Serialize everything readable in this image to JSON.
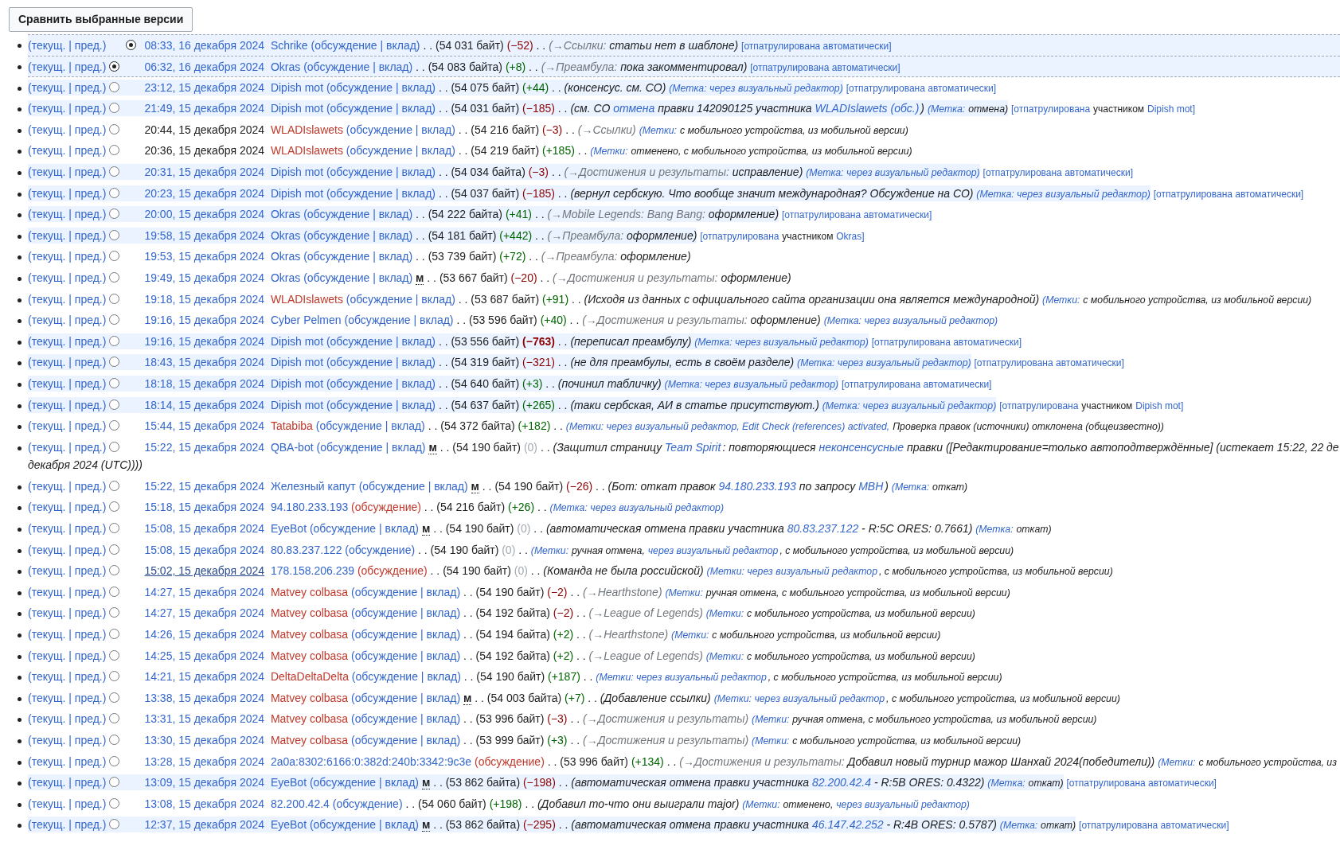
{
  "compare_button": "Сравнить выбранные версии",
  "rows": [
    {
      "cur": "(текущ.",
      "prev": "| пред.)",
      "second_radio": true,
      "selected": true,
      "highlighted": true,
      "time": {
        "text": "08:33, 16 декабря 2024",
        "color": "#3366cc",
        "visited": false
      },
      "user": "Schrike",
      "user_missing": false,
      "talk": "(обсуждение",
      "talk_missing": false,
      "contribs": "| вклад)",
      "size": ". . (54 031 байт)",
      "diff": {
        "text": "(−52)",
        "color": "#8b0000",
        "bold": false
      },
      "dots": ". .",
      "summary": [
        {
          "kind": "sec",
          "text": "(→Ссылки:"
        },
        {
          "kind": "txt",
          "text": "статьи нет в шаблоне)"
        },
        {
          "kind": "pat",
          "text": "[отпатрулирована автоматически]"
        }
      ]
    },
    {
      "cur": "(текущ.",
      "prev": "| пред.)",
      "second_radio": false,
      "selected": true,
      "highlighted": true,
      "time": {
        "text": "06:32, 16 декабря 2024",
        "color": "#3366cc",
        "visited": false
      },
      "user": "Okras",
      "user_missing": false,
      "talk": "(обсуждение",
      "talk_missing": false,
      "contribs": "| вклад)",
      "size": ". . (54 083 байта)",
      "diff": {
        "text": "(+8)",
        "color": "#006400",
        "bold": false
      },
      "dots": ". .",
      "summary": [
        {
          "kind": "sec",
          "text": "(→Преамбула:"
        },
        {
          "kind": "txt",
          "text": "пока закомментировал)"
        },
        {
          "kind": "pat",
          "text": "[отпатрулирована автоматически]"
        }
      ]
    },
    {
      "cur": "(текущ.",
      "prev": "| пред.)",
      "second_radio": false,
      "selected": false,
      "highlighted": true,
      "time": {
        "text": "23:12, 15 декабря 2024",
        "color": "#3366cc",
        "visited": false
      },
      "user": "Dipish mot",
      "user_missing": false,
      "talk": "(обсуждение",
      "talk_missing": false,
      "contribs": "| вклад)",
      "size": ". . (54 075 байт)",
      "diff": {
        "text": "(+44)",
        "color": "#006400",
        "bold": false
      },
      "dots": ". .",
      "summary": [
        {
          "kind": "txt",
          "text": "(консенсус. см. СО)"
        },
        {
          "kind": "tag",
          "text": "(Метка: через визуальный редактор)"
        },
        {
          "kind": "pat",
          "text": "[отпатрулирована автоматически]"
        }
      ]
    },
    {
      "cur": "(текущ.",
      "prev": "| пред.)",
      "second_radio": false,
      "selected": false,
      "highlighted": true,
      "time": {
        "text": "21:49, 15 декабря 2024",
        "color": "#3366cc",
        "visited": false
      },
      "user": "Dipish mot",
      "user_missing": false,
      "talk": "(обсуждение",
      "talk_missing": false,
      "contribs": "| вклад)",
      "size": ". . (54 031 байт)",
      "diff": {
        "text": "(−185)",
        "color": "#8b0000",
        "bold": false
      },
      "dots": ". .",
      "summary": [
        {
          "kind": "txt",
          "text": "(см. СО"
        },
        {
          "kind": "link",
          "text": "отмена"
        },
        {
          "kind": "txt",
          "text": "правки 142090125 участника"
        },
        {
          "kind": "link",
          "text": "WLADIslawets"
        },
        {
          "kind": "link",
          "text": "(обс.)"
        },
        {
          "kind": "txt",
          "text": ")",
          "nospace": true
        },
        {
          "kind": "tag",
          "text": "(Метка:"
        },
        {
          "kind": "ttx",
          "text": "отмена)"
        },
        {
          "kind": "pat",
          "text": "[отпатрулирована"
        },
        {
          "kind": "ptx",
          "text": "участником"
        },
        {
          "kind": "pat",
          "text": "Dipish mot]"
        }
      ]
    },
    {
      "cur": "(текущ.",
      "prev": "| пред.)",
      "second_radio": false,
      "selected": false,
      "highlighted": false,
      "time": {
        "text": "20:44, 15 декабря 2024",
        "color": "#202122",
        "visited": false
      },
      "user": "WLADIslawets",
      "user_missing": true,
      "talk": "(обсуждение",
      "talk_missing": false,
      "contribs": "| вклад)",
      "size": ". . (54 216 байт)",
      "diff": {
        "text": "(−3)",
        "color": "#8b0000",
        "bold": false
      },
      "dots": ". .",
      "summary": [
        {
          "kind": "sec",
          "text": "(→Ссылки)"
        },
        {
          "kind": "tag",
          "text": "(Метки:"
        },
        {
          "kind": "ttx",
          "text": "с мобильного устройства, из мобильной версии)"
        }
      ]
    },
    {
      "cur": "(текущ.",
      "prev": "| пред.)",
      "second_radio": false,
      "selected": false,
      "highlighted": false,
      "time": {
        "text": "20:36, 15 декабря 2024",
        "color": "#202122",
        "visited": false
      },
      "user": "WLADIslawets",
      "user_missing": true,
      "talk": "(обсуждение",
      "talk_missing": false,
      "contribs": "| вклад)",
      "size": ". . (54 219 байт)",
      "diff": {
        "text": "(+185)",
        "color": "#006400",
        "bold": false
      },
      "dots": ". .",
      "summary": [
        {
          "kind": "tag",
          "text": "(Метки:"
        },
        {
          "kind": "ttx",
          "text": "отменено, с мобильного устройства, из мобильной версии)"
        }
      ]
    },
    {
      "cur": "(текущ.",
      "prev": "| пред.)",
      "second_radio": false,
      "selected": false,
      "highlighted": true,
      "time": {
        "text": "20:31, 15 декабря 2024",
        "color": "#3366cc",
        "visited": false
      },
      "user": "Dipish mot",
      "user_missing": false,
      "talk": "(обсуждение",
      "talk_missing": false,
      "contribs": "| вклад)",
      "size": ". . (54 034 байта)",
      "diff": {
        "text": "(−3)",
        "color": "#8b0000",
        "bold": false
      },
      "dots": ". .",
      "summary": [
        {
          "kind": "sec",
          "text": "(→Достижения и результаты:"
        },
        {
          "kind": "txt",
          "text": "исправление)"
        },
        {
          "kind": "tag",
          "text": "(Метка: через визуальный редактор)"
        },
        {
          "kind": "pat",
          "text": "[отпатрулирована автоматически]"
        }
      ]
    },
    {
      "cur": "(текущ.",
      "prev": "| пред.)",
      "second_radio": false,
      "selected": false,
      "highlighted": true,
      "time": {
        "text": "20:23, 15 декабря 2024",
        "color": "#3366cc",
        "visited": false
      },
      "user": "Dipish mot",
      "user_missing": false,
      "talk": "(обсуждение",
      "talk_missing": false,
      "contribs": "| вклад)",
      "size": ". . (54 037 байт)",
      "diff": {
        "text": "(−185)",
        "color": "#8b0000",
        "bold": false
      },
      "dots": ". .",
      "summary": [
        {
          "kind": "txt",
          "text": "(вернул сербскую. Что вообще значит международная? Обсуждение на СО)"
        },
        {
          "kind": "tag",
          "text": "(Метка: через визуальный редактор)"
        },
        {
          "kind": "pat",
          "text": "[отпатрулирована автоматически]"
        }
      ]
    },
    {
      "cur": "(текущ.",
      "prev": "| пред.)",
      "second_radio": false,
      "selected": false,
      "highlighted": true,
      "time": {
        "text": "20:00, 15 декабря 2024",
        "color": "#3366cc",
        "visited": false
      },
      "user": "Okras",
      "user_missing": false,
      "talk": "(обсуждение",
      "talk_missing": false,
      "contribs": "| вклад)",
      "size": ". . (54 222 байта)",
      "diff": {
        "text": "(+41)",
        "color": "#006400",
        "bold": false
      },
      "dots": ". .",
      "summary": [
        {
          "kind": "sec",
          "text": "(→Mobile Legends: Bang Bang:"
        },
        {
          "kind": "txt",
          "text": "оформление)"
        },
        {
          "kind": "pat",
          "text": "[отпатрулирована автоматически]"
        }
      ]
    },
    {
      "cur": "(текущ.",
      "prev": "| пред.)",
      "second_radio": false,
      "selected": false,
      "highlighted": true,
      "time": {
        "text": "19:58, 15 декабря 2024",
        "color": "#3366cc",
        "visited": false
      },
      "user": "Okras",
      "user_missing": false,
      "talk": "(обсуждение",
      "talk_missing": false,
      "contribs": "| вклад)",
      "size": ". . (54 181 байт)",
      "diff": {
        "text": "(+442)",
        "color": "#006400",
        "bold": false
      },
      "dots": ". .",
      "summary": [
        {
          "kind": "sec",
          "text": "(→Преамбула:"
        },
        {
          "kind": "txt",
          "text": "оформление)"
        },
        {
          "kind": "pat",
          "text": "[отпатрулирована"
        },
        {
          "kind": "ptx",
          "text": "участником"
        },
        {
          "kind": "pat",
          "text": "Okras]"
        }
      ]
    },
    {
      "cur": "(текущ.",
      "prev": "| пред.)",
      "second_radio": false,
      "selected": false,
      "highlighted": false,
      "time": {
        "text": "19:53, 15 декабря 2024",
        "color": "#3366cc",
        "visited": false
      },
      "user": "Okras",
      "user_missing": false,
      "talk": "(обсуждение",
      "talk_missing": false,
      "contribs": "| вклад)",
      "size": ". . (53 739 байт)",
      "diff": {
        "text": "(+72)",
        "color": "#006400",
        "bold": false
      },
      "dots": ". .",
      "summary": [
        {
          "kind": "sec",
          "text": "(→Преамбула:"
        },
        {
          "kind": "txt",
          "text": "оформление)"
        }
      ]
    },
    {
      "cur": "(текущ.",
      "prev": "| пред.)",
      "second_radio": false,
      "selected": false,
      "highlighted": false,
      "time": {
        "text": "19:49, 15 декабря 2024",
        "color": "#3366cc",
        "visited": false
      },
      "user": "Okras",
      "user_missing": false,
      "talk": "(обсуждение",
      "talk_missing": false,
      "contribs": "| вклад)",
      "minor": "м",
      "size": ". . (53 667 байт)",
      "diff": {
        "text": "(−20)",
        "color": "#8b0000",
        "bold": false
      },
      "dots": ". .",
      "summary": [
        {
          "kind": "sec",
          "text": "(→Достижения и результаты:"
        },
        {
          "kind": "txt",
          "text": "оформление)"
        }
      ]
    },
    {
      "cur": "(текущ.",
      "prev": "| пред.)",
      "second_radio": false,
      "selected": false,
      "highlighted": false,
      "time": {
        "text": "19:18, 15 декабря 2024",
        "color": "#3366cc",
        "visited": false
      },
      "user": "WLADIslawets",
      "user_missing": true,
      "talk": "(обсуждение",
      "talk_missing": false,
      "contribs": "| вклад)",
      "size": ". . (53 687 байт)",
      "diff": {
        "text": "(+91)",
        "color": "#006400",
        "bold": false
      },
      "dots": ". .",
      "summary": [
        {
          "kind": "txt",
          "text": "(Исходя из данных с официального сайта организации она является международной)"
        },
        {
          "kind": "tag",
          "text": "(Метки:"
        },
        {
          "kind": "ttx",
          "text": "с мобильного устройства, из мобильной версии)"
        }
      ]
    },
    {
      "cur": "(текущ.",
      "prev": "| пред.)",
      "second_radio": false,
      "selected": false,
      "highlighted": false,
      "time": {
        "text": "19:16, 15 декабря 2024",
        "color": "#3366cc",
        "visited": false
      },
      "user": "Cyber Pelmen",
      "user_missing": false,
      "talk": "(обсуждение",
      "talk_missing": false,
      "contribs": "| вклад)",
      "size": ". . (53 596 байт)",
      "diff": {
        "text": "(+40)",
        "color": "#006400",
        "bold": false
      },
      "dots": ". .",
      "summary": [
        {
          "kind": "sec",
          "text": "(→Достижения и результаты:"
        },
        {
          "kind": "txt",
          "text": "оформление)"
        },
        {
          "kind": "tag",
          "text": "(Метка: через визуальный редактор)"
        }
      ]
    },
    {
      "cur": "(текущ.",
      "prev": "| пред.)",
      "second_radio": false,
      "selected": false,
      "highlighted": true,
      "time": {
        "text": "19:16, 15 декабря 2024",
        "color": "#3366cc",
        "visited": false
      },
      "user": "Dipish mot",
      "user_missing": false,
      "talk": "(обсуждение",
      "talk_missing": false,
      "contribs": "| вклад)",
      "size": ". . (53 556 байт)",
      "diff": {
        "text": "(−763)",
        "color": "#8b0000",
        "bold": true
      },
      "dots": ". .",
      "summary": [
        {
          "kind": "txt",
          "text": "(переписал преамбулу)"
        },
        {
          "kind": "tag",
          "text": "(Метка: через визуальный редактор)"
        },
        {
          "kind": "pat",
          "text": "[отпатрулирована автоматически]"
        }
      ]
    },
    {
      "cur": "(текущ.",
      "prev": "| пред.)",
      "second_radio": false,
      "selected": false,
      "highlighted": true,
      "time": {
        "text": "18:43, 15 декабря 2024",
        "color": "#3366cc",
        "visited": false
      },
      "user": "Dipish mot",
      "user_missing": false,
      "talk": "(обсуждение",
      "talk_missing": false,
      "contribs": "| вклад)",
      "size": ". . (54 319 байт)",
      "diff": {
        "text": "(−321)",
        "color": "#8b0000",
        "bold": false
      },
      "dots": ". .",
      "summary": [
        {
          "kind": "txt",
          "text": "(не для преамбулы, есть в своём разделе)"
        },
        {
          "kind": "tag",
          "text": "(Метка: через визуальный редактор)"
        },
        {
          "kind": "pat",
          "text": "[отпатрулирована автоматически]"
        }
      ]
    },
    {
      "cur": "(текущ.",
      "prev": "| пред.)",
      "second_radio": false,
      "selected": false,
      "highlighted": true,
      "time": {
        "text": "18:18, 15 декабря 2024",
        "color": "#3366cc",
        "visited": false
      },
      "user": "Dipish mot",
      "user_missing": false,
      "talk": "(обсуждение",
      "talk_missing": false,
      "contribs": "| вклад)",
      "size": ". . (54 640 байт)",
      "diff": {
        "text": "(+3)",
        "color": "#006400",
        "bold": false
      },
      "dots": ". .",
      "summary": [
        {
          "kind": "txt",
          "text": "(починил табличку)"
        },
        {
          "kind": "tag",
          "text": "(Метка: через визуальный редактор)"
        },
        {
          "kind": "pat",
          "text": "[отпатрулирована автоматически]"
        }
      ]
    },
    {
      "cur": "(текущ.",
      "prev": "| пред.)",
      "second_radio": false,
      "selected": false,
      "highlighted": true,
      "time": {
        "text": "18:14, 15 декабря 2024",
        "color": "#3366cc",
        "visited": false
      },
      "user": "Dipish mot",
      "user_missing": false,
      "talk": "(обсуждение",
      "talk_missing": false,
      "contribs": "| вклад)",
      "size": ". . (54 637 байт)",
      "diff": {
        "text": "(+265)",
        "color": "#006400",
        "bold": false
      },
      "dots": ". .",
      "summary": [
        {
          "kind": "txt",
          "text": "(таки сербская, АИ в статье присутствуют.)"
        },
        {
          "kind": "tag",
          "text": "(Метка: через визуальный редактор)"
        },
        {
          "kind": "pat",
          "text": "[отпатрулирована"
        },
        {
          "kind": "ptx",
          "text": "участником"
        },
        {
          "kind": "pat",
          "text": "Dipish mot]"
        }
      ]
    },
    {
      "cur": "(текущ.",
      "prev": "| пред.)",
      "second_radio": false,
      "selected": false,
      "highlighted": false,
      "time": {
        "text": "15:44, 15 декабря 2024",
        "color": "#3366cc",
        "visited": false
      },
      "user": "Tatabiba",
      "user_missing": true,
      "talk": "(обсуждение",
      "talk_missing": false,
      "contribs": "| вклад)",
      "size": ". . (54 372 байта)",
      "diff": {
        "text": "(+182)",
        "color": "#006400",
        "bold": false
      },
      "dots": ". .",
      "summary": [
        {
          "kind": "tag",
          "text": "(Метки: через визуальный редактор, Edit Check (references) activated,"
        },
        {
          "kind": "ttx",
          "text": "Проверка правок (источники) отклонена (общеизвестно))"
        }
      ]
    },
    {
      "cur": "(текущ.",
      "prev": "| пред.)",
      "second_radio": false,
      "selected": false,
      "highlighted": false,
      "time": {
        "text": "15:22, 15 декабря 2024",
        "color": "#3366cc",
        "visited": false
      },
      "user": "QBA-bot",
      "user_missing": false,
      "talk": "(обсуждение",
      "talk_missing": false,
      "contribs": "| вклад)",
      "minor": "м",
      "size": ". . (54 190 байт)",
      "diff": {
        "text": "(0)",
        "color": "#a2a9b1",
        "bold": false
      },
      "dots": ". .",
      "summary": [
        {
          "kind": "txt",
          "text": "(Защитил страницу"
        },
        {
          "kind": "link",
          "text": "Team Spirit"
        },
        {
          "kind": "txt",
          "text": ": повторяющиеся",
          "nospace": true
        },
        {
          "kind": "link",
          "text": "неконсенсусные"
        },
        {
          "kind": "txt",
          "text": "правки ([Редактирование=только автоподтверждённые] (истекает 15:22, 22 де"
        },
        {
          "kind": "txt",
          "text": "декабря 2024 (UTC))))",
          "newline": true
        }
      ]
    },
    {
      "cur": "(текущ.",
      "prev": "| пред.)",
      "second_radio": false,
      "selected": false,
      "highlighted": false,
      "time": {
        "text": "15:22, 15 декабря 2024",
        "color": "#3366cc",
        "visited": false
      },
      "user": "Железный капут",
      "user_missing": false,
      "talk": "(обсуждение",
      "talk_missing": false,
      "contribs": "| вклад)",
      "minor": "м",
      "size": ". . (54 190 байт)",
      "diff": {
        "text": "(−26)",
        "color": "#8b0000",
        "bold": false
      },
      "dots": ". .",
      "summary": [
        {
          "kind": "txt",
          "text": "(Бот: откат правок"
        },
        {
          "kind": "link",
          "text": "94.180.233.193"
        },
        {
          "kind": "txt",
          "text": "по запросу"
        },
        {
          "kind": "link",
          "text": "MBH"
        },
        {
          "kind": "txt",
          "text": ")",
          "nospace": true
        },
        {
          "kind": "tag",
          "text": "(Метка:"
        },
        {
          "kind": "ttx",
          "text": "откат)"
        }
      ]
    },
    {
      "cur": "(текущ.",
      "prev": "| пред.)",
      "second_radio": false,
      "selected": false,
      "highlighted": false,
      "time": {
        "text": "15:18, 15 декабря 2024",
        "color": "#3366cc",
        "visited": false
      },
      "user": "94.180.233.193",
      "user_missing": false,
      "talk": "(обсуждение)",
      "talk_missing": true,
      "size": ". . (54 216 байт)",
      "diff": {
        "text": "(+26)",
        "color": "#006400",
        "bold": false
      },
      "dots": ". .",
      "summary": [
        {
          "kind": "tag",
          "text": "(Метка: через визуальный редактор)"
        }
      ]
    },
    {
      "cur": "(текущ.",
      "prev": "| пред.)",
      "second_radio": false,
      "selected": false,
      "highlighted": false,
      "time": {
        "text": "15:08, 15 декабря 2024",
        "color": "#3366cc",
        "visited": false
      },
      "user": "EyeBot",
      "user_missing": false,
      "talk": "(обсуждение",
      "talk_missing": false,
      "contribs": "| вклад)",
      "minor": "м",
      "size": ". . (54 190 байт)",
      "diff": {
        "text": "(0)",
        "color": "#a2a9b1",
        "bold": false
      },
      "dots": ". .",
      "summary": [
        {
          "kind": "txt",
          "text": "(автоматическая отмена правки участника"
        },
        {
          "kind": "link",
          "text": "80.83.237.122"
        },
        {
          "kind": "txt",
          "text": "- R:5C ORES: 0.7661)"
        },
        {
          "kind": "tag",
          "text": "(Метка:"
        },
        {
          "kind": "ttx",
          "text": "откат)"
        }
      ]
    },
    {
      "cur": "(текущ.",
      "prev": "| пред.)",
      "second_radio": false,
      "selected": false,
      "highlighted": false,
      "time": {
        "text": "15:08, 15 декабря 2024",
        "color": "#3366cc",
        "visited": false
      },
      "user": "80.83.237.122",
      "user_missing": false,
      "talk": "(обсуждение)",
      "talk_missing": false,
      "size": ". . (54 190 байт)",
      "diff": {
        "text": "(0)",
        "color": "#a2a9b1",
        "bold": false
      },
      "dots": ". .",
      "summary": [
        {
          "kind": "tag",
          "text": "(Метки:"
        },
        {
          "kind": "ttx",
          "text": "ручная отмена,"
        },
        {
          "kind": "tag",
          "text": "через визуальный редактор"
        },
        {
          "kind": "ttx",
          "text": ", с мобильного устройства, из мобильной версии)",
          "nospace": true
        }
      ]
    },
    {
      "cur": "(текущ.",
      "prev": "| пред.)",
      "second_radio": false,
      "selected": false,
      "highlighted": false,
      "time": {
        "text": "15:02, 15 декабря 2024",
        "color": "#2a4b8d",
        "visited": true
      },
      "user": "178.158.206.239",
      "user_missing": false,
      "talk": "(обсуждение)",
      "talk_missing": true,
      "size": ". . (54 190 байт)",
      "diff": {
        "text": "(0)",
        "color": "#a2a9b1",
        "bold": false
      },
      "dots": ". .",
      "summary": [
        {
          "kind": "txt",
          "text": "(Команда не была российской)"
        },
        {
          "kind": "tag",
          "text": "(Метки: через визуальный редактор"
        },
        {
          "kind": "ttx",
          "text": ", с мобильного устройства, из мобильной версии)",
          "nospace": true
        }
      ]
    },
    {
      "cur": "(текущ.",
      "prev": "| пред.)",
      "second_radio": false,
      "selected": false,
      "highlighted": false,
      "time": {
        "text": "14:27, 15 декабря 2024",
        "color": "#3366cc",
        "visited": false
      },
      "user": "Matvey colbasa",
      "user_missing": true,
      "talk": "(обсуждение",
      "talk_missing": false,
      "contribs": "| вклад)",
      "size": ". . (54 190 байт)",
      "diff": {
        "text": "(−2)",
        "color": "#8b0000",
        "bold": false
      },
      "dots": ". .",
      "summary": [
        {
          "kind": "sec",
          "text": "(→Hearthstone)"
        },
        {
          "kind": "tag",
          "text": "(Метки:"
        },
        {
          "kind": "ttx",
          "text": "ручная отмена, с мобильного устройства, из мобильной версии)"
        }
      ]
    },
    {
      "cur": "(текущ.",
      "prev": "| пред.)",
      "second_radio": false,
      "selected": false,
      "highlighted": false,
      "time": {
        "text": "14:27, 15 декабря 2024",
        "color": "#3366cc",
        "visited": false
      },
      "user": "Matvey colbasa",
      "user_missing": true,
      "talk": "(обсуждение",
      "talk_missing": false,
      "contribs": "| вклад)",
      "size": ". . (54 192 байта)",
      "diff": {
        "text": "(−2)",
        "color": "#8b0000",
        "bold": false
      },
      "dots": ". .",
      "summary": [
        {
          "kind": "sec",
          "text": "(→League of Legends)"
        },
        {
          "kind": "tag",
          "text": "(Метки:"
        },
        {
          "kind": "ttx",
          "text": "с мобильного устройства, из мобильной версии)"
        }
      ]
    },
    {
      "cur": "(текущ.",
      "prev": "| пред.)",
      "second_radio": false,
      "selected": false,
      "highlighted": false,
      "time": {
        "text": "14:26, 15 декабря 2024",
        "color": "#3366cc",
        "visited": false
      },
      "user": "Matvey colbasa",
      "user_missing": true,
      "talk": "(обсуждение",
      "talk_missing": false,
      "contribs": "| вклад)",
      "size": ". . (54 194 байта)",
      "diff": {
        "text": "(+2)",
        "color": "#006400",
        "bold": false
      },
      "dots": ". .",
      "summary": [
        {
          "kind": "sec",
          "text": "(→Hearthstone)"
        },
        {
          "kind": "tag",
          "text": "(Метки:"
        },
        {
          "kind": "ttx",
          "text": "с мобильного устройства, из мобильной версии)"
        }
      ]
    },
    {
      "cur": "(текущ.",
      "prev": "| пред.)",
      "second_radio": false,
      "selected": false,
      "highlighted": false,
      "time": {
        "text": "14:25, 15 декабря 2024",
        "color": "#3366cc",
        "visited": false
      },
      "user": "Matvey colbasa",
      "user_missing": true,
      "talk": "(обсуждение",
      "talk_missing": false,
      "contribs": "| вклад)",
      "size": ". . (54 192 байта)",
      "diff": {
        "text": "(+2)",
        "color": "#006400",
        "bold": false
      },
      "dots": ". .",
      "summary": [
        {
          "kind": "sec",
          "text": "(→League of Legends)"
        },
        {
          "kind": "tag",
          "text": "(Метки:"
        },
        {
          "kind": "ttx",
          "text": "с мобильного устройства, из мобильной версии)"
        }
      ]
    },
    {
      "cur": "(текущ.",
      "prev": "| пред.)",
      "second_radio": false,
      "selected": false,
      "highlighted": false,
      "time": {
        "text": "14:21, 15 декабря 2024",
        "color": "#3366cc",
        "visited": false
      },
      "user": "DeltaDeltaDelta",
      "user_missing": true,
      "talk": "(обсуждение",
      "talk_missing": false,
      "contribs": "| вклад)",
      "size": ". . (54 190 байт)",
      "diff": {
        "text": "(+187)",
        "color": "#006400",
        "bold": false
      },
      "dots": ". .",
      "summary": [
        {
          "kind": "tag",
          "text": "(Метки: через визуальный редактор"
        },
        {
          "kind": "ttx",
          "text": ", с мобильного устройства, из мобильной версии)",
          "nospace": true
        }
      ]
    },
    {
      "cur": "(текущ.",
      "prev": "| пред.)",
      "second_radio": false,
      "selected": false,
      "highlighted": false,
      "time": {
        "text": "13:38, 15 декабря 2024",
        "color": "#3366cc",
        "visited": false
      },
      "user": "Matvey colbasa",
      "user_missing": true,
      "talk": "(обсуждение",
      "talk_missing": false,
      "contribs": "| вклад)",
      "minor": "м",
      "size": ". . (54 003 байта)",
      "diff": {
        "text": "(+7)",
        "color": "#006400",
        "bold": false
      },
      "dots": ". .",
      "summary": [
        {
          "kind": "txt",
          "text": "(Добавление ссылки)"
        },
        {
          "kind": "tag",
          "text": "(Метки: через визуальный редактор"
        },
        {
          "kind": "ttx",
          "text": ", с мобильного устройства, из мобильной версии)",
          "nospace": true
        }
      ]
    },
    {
      "cur": "(текущ.",
      "prev": "| пред.)",
      "second_radio": false,
      "selected": false,
      "highlighted": false,
      "time": {
        "text": "13:31, 15 декабря 2024",
        "color": "#3366cc",
        "visited": false
      },
      "user": "Matvey colbasa",
      "user_missing": true,
      "talk": "(обсуждение",
      "talk_missing": false,
      "contribs": "| вклад)",
      "size": ". . (53 996 байт)",
      "diff": {
        "text": "(−3)",
        "color": "#8b0000",
        "bold": false
      },
      "dots": ". .",
      "summary": [
        {
          "kind": "sec",
          "text": "(→Достижения и результаты)"
        },
        {
          "kind": "tag",
          "text": "(Метки:"
        },
        {
          "kind": "ttx",
          "text": "ручная отмена, с мобильного устройства, из мобильной версии)"
        }
      ]
    },
    {
      "cur": "(текущ.",
      "prev": "| пред.)",
      "second_radio": false,
      "selected": false,
      "highlighted": false,
      "time": {
        "text": "13:30, 15 декабря 2024",
        "color": "#3366cc",
        "visited": false
      },
      "user": "Matvey colbasa",
      "user_missing": true,
      "talk": "(обсуждение",
      "talk_missing": false,
      "contribs": "| вклад)",
      "size": ". . (53 999 байт)",
      "diff": {
        "text": "(+3)",
        "color": "#006400",
        "bold": false
      },
      "dots": ". .",
      "summary": [
        {
          "kind": "sec",
          "text": "(→Достижения и результаты)"
        },
        {
          "kind": "tag",
          "text": "(Метки:"
        },
        {
          "kind": "ttx",
          "text": "с мобильного устройства, из мобильной версии)"
        }
      ]
    },
    {
      "cur": "(текущ.",
      "prev": "| пред.)",
      "second_radio": false,
      "selected": false,
      "highlighted": false,
      "time": {
        "text": "13:28, 15 декабря 2024",
        "color": "#3366cc",
        "visited": false
      },
      "user": "2a0a:8302:6166:0:382d:240b:3342:9c3e",
      "user_missing": false,
      "talk": "(обсуждение)",
      "talk_missing": true,
      "size": ". . (53 996 байт)",
      "diff": {
        "text": "(+134)",
        "color": "#006400",
        "bold": false
      },
      "dots": ". .",
      "summary": [
        {
          "kind": "sec",
          "text": "(→Достижения и результаты:"
        },
        {
          "kind": "txt",
          "text": "Добавил новый турнир мажор Шанхай 2024(победители))"
        },
        {
          "kind": "tag",
          "text": "(Метки:"
        },
        {
          "kind": "ttx",
          "text": "с мобильного устройства, из"
        }
      ]
    },
    {
      "cur": "(текущ.",
      "prev": "| пред.)",
      "second_radio": false,
      "selected": false,
      "highlighted": true,
      "time": {
        "text": "13:09, 15 декабря 2024",
        "color": "#3366cc",
        "visited": false
      },
      "user": "EyeBot",
      "user_missing": false,
      "talk": "(обсуждение",
      "talk_missing": false,
      "contribs": "| вклад)",
      "minor": "м",
      "size": ". . (53 862 байта)",
      "diff": {
        "text": "(−198)",
        "color": "#8b0000",
        "bold": false
      },
      "dots": ". .",
      "summary": [
        {
          "kind": "txt",
          "text": "(автоматическая отмена правки участника"
        },
        {
          "kind": "link",
          "text": "82.200.42.4"
        },
        {
          "kind": "txt",
          "text": "- R:5B ORES: 0.4322)"
        },
        {
          "kind": "tag",
          "text": "(Метка:"
        },
        {
          "kind": "ttx",
          "text": "откат)"
        },
        {
          "kind": "pat",
          "text": "[отпатрулирована автоматически]"
        }
      ]
    },
    {
      "cur": "(текущ.",
      "prev": "| пред.)",
      "second_radio": false,
      "selected": false,
      "highlighted": false,
      "time": {
        "text": "13:08, 15 декабря 2024",
        "color": "#3366cc",
        "visited": false
      },
      "user": "82.200.42.4",
      "user_missing": false,
      "talk": "(обсуждение)",
      "talk_missing": false,
      "size": ". . (54 060 байт)",
      "diff": {
        "text": "(+198)",
        "color": "#006400",
        "bold": false
      },
      "dots": ". .",
      "summary": [
        {
          "kind": "txt",
          "text": "(Добавил то-что они выиграли major)"
        },
        {
          "kind": "tag",
          "text": "(Метки:"
        },
        {
          "kind": "ttx",
          "text": "отменено,"
        },
        {
          "kind": "tag",
          "text": "через визуальный редактор)"
        }
      ]
    },
    {
      "cur": "(текущ.",
      "prev": "| пред.)",
      "second_radio": false,
      "selected": false,
      "highlighted": true,
      "time": {
        "text": "12:37, 15 декабря 2024",
        "color": "#3366cc",
        "visited": false
      },
      "user": "EyeBot",
      "user_missing": false,
      "talk": "(обсуждение",
      "talk_missing": false,
      "contribs": "| вклад)",
      "minor": "м",
      "size": ". . (53 862 байта)",
      "diff": {
        "text": "(−295)",
        "color": "#8b0000",
        "bold": false
      },
      "dots": ". .",
      "summary": [
        {
          "kind": "txt",
          "text": "(автоматическая отмена правки участника"
        },
        {
          "kind": "link",
          "text": "46.147.42.252"
        },
        {
          "kind": "txt",
          "text": "- R:4B ORES: 0.5787)"
        },
        {
          "kind": "tag",
          "text": "(Метка:"
        },
        {
          "kind": "ttx",
          "text": "откат)"
        },
        {
          "kind": "pat",
          "text": "[отпатрулирована автоматически]"
        }
      ]
    }
  ]
}
